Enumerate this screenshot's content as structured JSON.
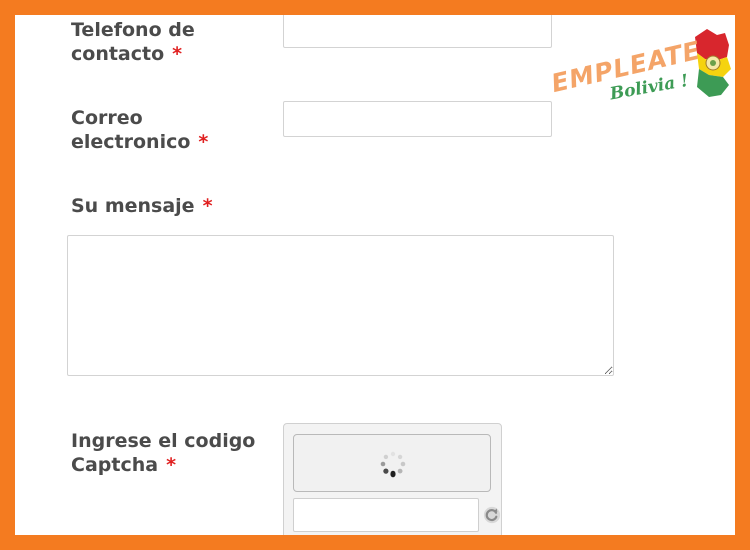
{
  "form": {
    "phone": {
      "label_line1": "Telefono de",
      "label_line2": "contacto",
      "required_mark": "*",
      "value": ""
    },
    "email": {
      "label_line1": "Correo",
      "label_line2": "electronico",
      "required_mark": "*",
      "value": ""
    },
    "message": {
      "label": "Su mensaje",
      "required_mark": "*",
      "value": ""
    },
    "captcha": {
      "label_line1": "Ingrese el codigo",
      "label_line2": "Captcha",
      "required_mark": "*",
      "value": ""
    }
  },
  "logo": {
    "brand_text": "EMPLEATE",
    "sub_text": "Bolivia !",
    "colors": {
      "orange": "#f47b20",
      "green": "#3d9b55",
      "red": "#d8262d",
      "yellow": "#f5d30f"
    }
  },
  "theme": {
    "frame": "#f47b20",
    "label": "#4b4b4b",
    "required": "#e02020"
  }
}
